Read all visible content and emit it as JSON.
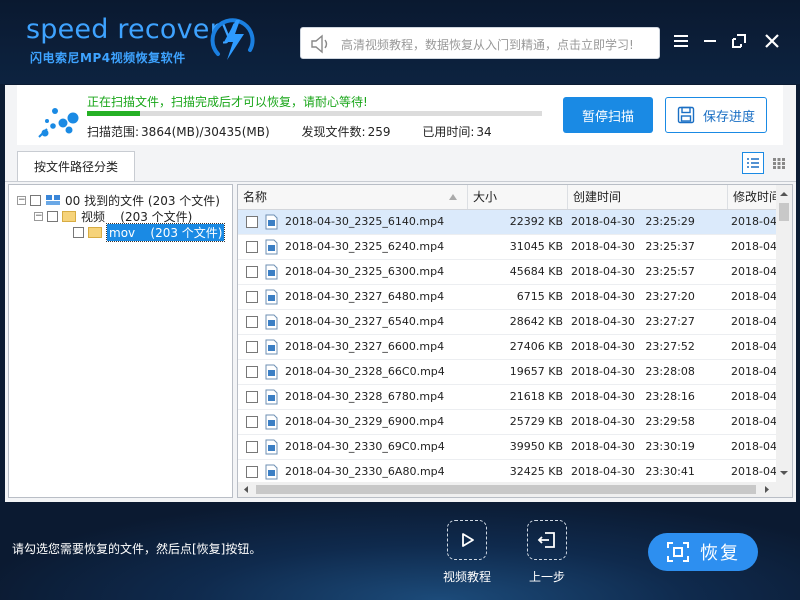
{
  "app": {
    "logo_text": "speed recovery",
    "subtitle": "闪电索尼MP4视频恢复软件",
    "notice": "高清视频教程，数据恢复从入门到精通，点击立即学习!",
    "colors": {
      "accent": "#1a8ae4",
      "progress": "#25b025",
      "status_text": "#19a619",
      "header_bg": "#0a1930"
    }
  },
  "window_controls": {
    "menu": "menu-icon",
    "minimize": "minimize-icon",
    "maximize": "maximize-icon",
    "close": "close-icon"
  },
  "scan": {
    "status": "正在扫描文件，扫描完成后才可以恢复，请耐心等待!",
    "progress": 0.116,
    "range_label": "扫描范围:",
    "range_value": "3864(MB)/30435(MB)",
    "found_label": "发现文件数:",
    "found_value": "259",
    "time_label": "已用时间:",
    "time_value": "34",
    "pause_label": "暂停扫描",
    "save_label": "保存进度"
  },
  "tabs": {
    "active": "按文件路径分类"
  },
  "tree": {
    "root": "00 找到的文件 (203 个文件)",
    "folder": "视频    (203 个文件)",
    "sub": "mov    (203 个文件)"
  },
  "table": {
    "columns": [
      "名称",
      "大小",
      "创建时间",
      "修改时间"
    ],
    "rows": [
      {
        "name": "2018-04-30_2325_6140.mp4",
        "size": "22392 KB",
        "created": "2018-04-30   23:25:29",
        "modified": "2018-04-"
      },
      {
        "name": "2018-04-30_2325_6240.mp4",
        "size": "31045 KB",
        "created": "2018-04-30   23:25:37",
        "modified": "2018-04-"
      },
      {
        "name": "2018-04-30_2325_6300.mp4",
        "size": "45684 KB",
        "created": "2018-04-30   23:25:57",
        "modified": "2018-04-"
      },
      {
        "name": "2018-04-30_2327_6480.mp4",
        "size": "6715 KB",
        "created": "2018-04-30   23:27:20",
        "modified": "2018-04-"
      },
      {
        "name": "2018-04-30_2327_6540.mp4",
        "size": "28642 KB",
        "created": "2018-04-30   23:27:27",
        "modified": "2018-04-"
      },
      {
        "name": "2018-04-30_2327_6600.mp4",
        "size": "27406 KB",
        "created": "2018-04-30   23:27:52",
        "modified": "2018-04-"
      },
      {
        "name": "2018-04-30_2328_66C0.mp4",
        "size": "19657 KB",
        "created": "2018-04-30   23:28:08",
        "modified": "2018-04-"
      },
      {
        "name": "2018-04-30_2328_6780.mp4",
        "size": "21618 KB",
        "created": "2018-04-30   23:28:16",
        "modified": "2018-04-"
      },
      {
        "name": "2018-04-30_2329_6900.mp4",
        "size": "25729 KB",
        "created": "2018-04-30   23:29:58",
        "modified": "2018-04-"
      },
      {
        "name": "2018-04-30_2330_69C0.mp4",
        "size": "39950 KB",
        "created": "2018-04-30   23:30:19",
        "modified": "2018-04-"
      },
      {
        "name": "2018-04-30_2330_6A80.mp4",
        "size": "32425 KB",
        "created": "2018-04-30   23:30:41",
        "modified": "2018-04-"
      }
    ]
  },
  "bottom": {
    "hint": "请勾选您需要恢复的文件，然后点[恢复]按钮。",
    "video_tutorial": "视频教程",
    "prev_step": "上一步",
    "recover": "恢复"
  }
}
